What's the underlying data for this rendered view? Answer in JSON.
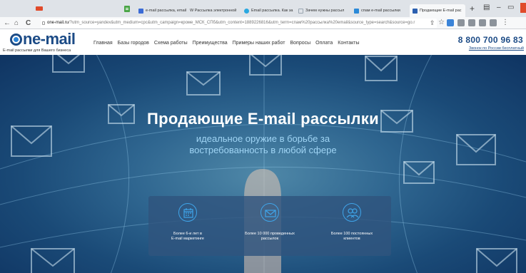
{
  "browser": {
    "tabs": [
      {
        "label": "e-mail рассылка, email",
        "favicon_color": "#3b6bd6"
      },
      {
        "label": "W Рассылка электронной",
        "favicon_color": "#ffffff"
      },
      {
        "label": "Email рассылка. Как за",
        "favicon_color": "#2aa8e0"
      },
      {
        "label": "Зачем нужны рассыл",
        "favicon_color": "#9aa5b0"
      },
      {
        "label": "спам e-mail рассылки",
        "favicon_color": "#2b8ad8"
      },
      {
        "label": "Продающие E-mail рас",
        "favicon_color": "#2b5fb0"
      }
    ],
    "new_tab_label": "+",
    "window_controls": {
      "minimize": "–",
      "restore": "▭"
    },
    "nav": {
      "back": "←",
      "home": "⌂",
      "reload": "C"
    },
    "url": {
      "host": "one-mail.ru",
      "rest": "/?utm_source=yandex&utm_medium=cpc&utm_campaign=кроме_МСК_СПб&utm_content=1889226816&utm_term=спам%20рассылка%20email&source_type=search&source=go.r"
    }
  },
  "site": {
    "logo": {
      "text": "ne-mail",
      "tagline": "E-mail рассылки для Вашего бизнеса"
    },
    "nav": [
      "Главная",
      "Базы городов",
      "Схема работы",
      "Преимущества",
      "Примеры наших работ",
      "Вопросы",
      "Оплата",
      "Контакты"
    ],
    "phone": "8 800 700 96 83",
    "phone_note": "Звонок по России бесплатный"
  },
  "hero": {
    "title": "Продающие E-mail рассылки",
    "subtitle_line1": "идеальное оружие в борьбе за",
    "subtitle_line2": "востребованность в любой сфере",
    "stats": [
      {
        "icon": "calendar-icon",
        "line1": "Более 6-и лет в",
        "line2": "E-mail маркетинге"
      },
      {
        "icon": "envelope-icon",
        "line1": "Более 10 000 проведенных",
        "line2": "рассылок"
      },
      {
        "icon": "clients-icon",
        "line1": "Более 100 постоянных",
        "line2": "клиентов"
      }
    ]
  },
  "colors": {
    "brand": "#1c4b86",
    "accent": "#3fa5ea",
    "hero_subtitle": "#9fd4f4",
    "stats_panel": "#30547e"
  }
}
